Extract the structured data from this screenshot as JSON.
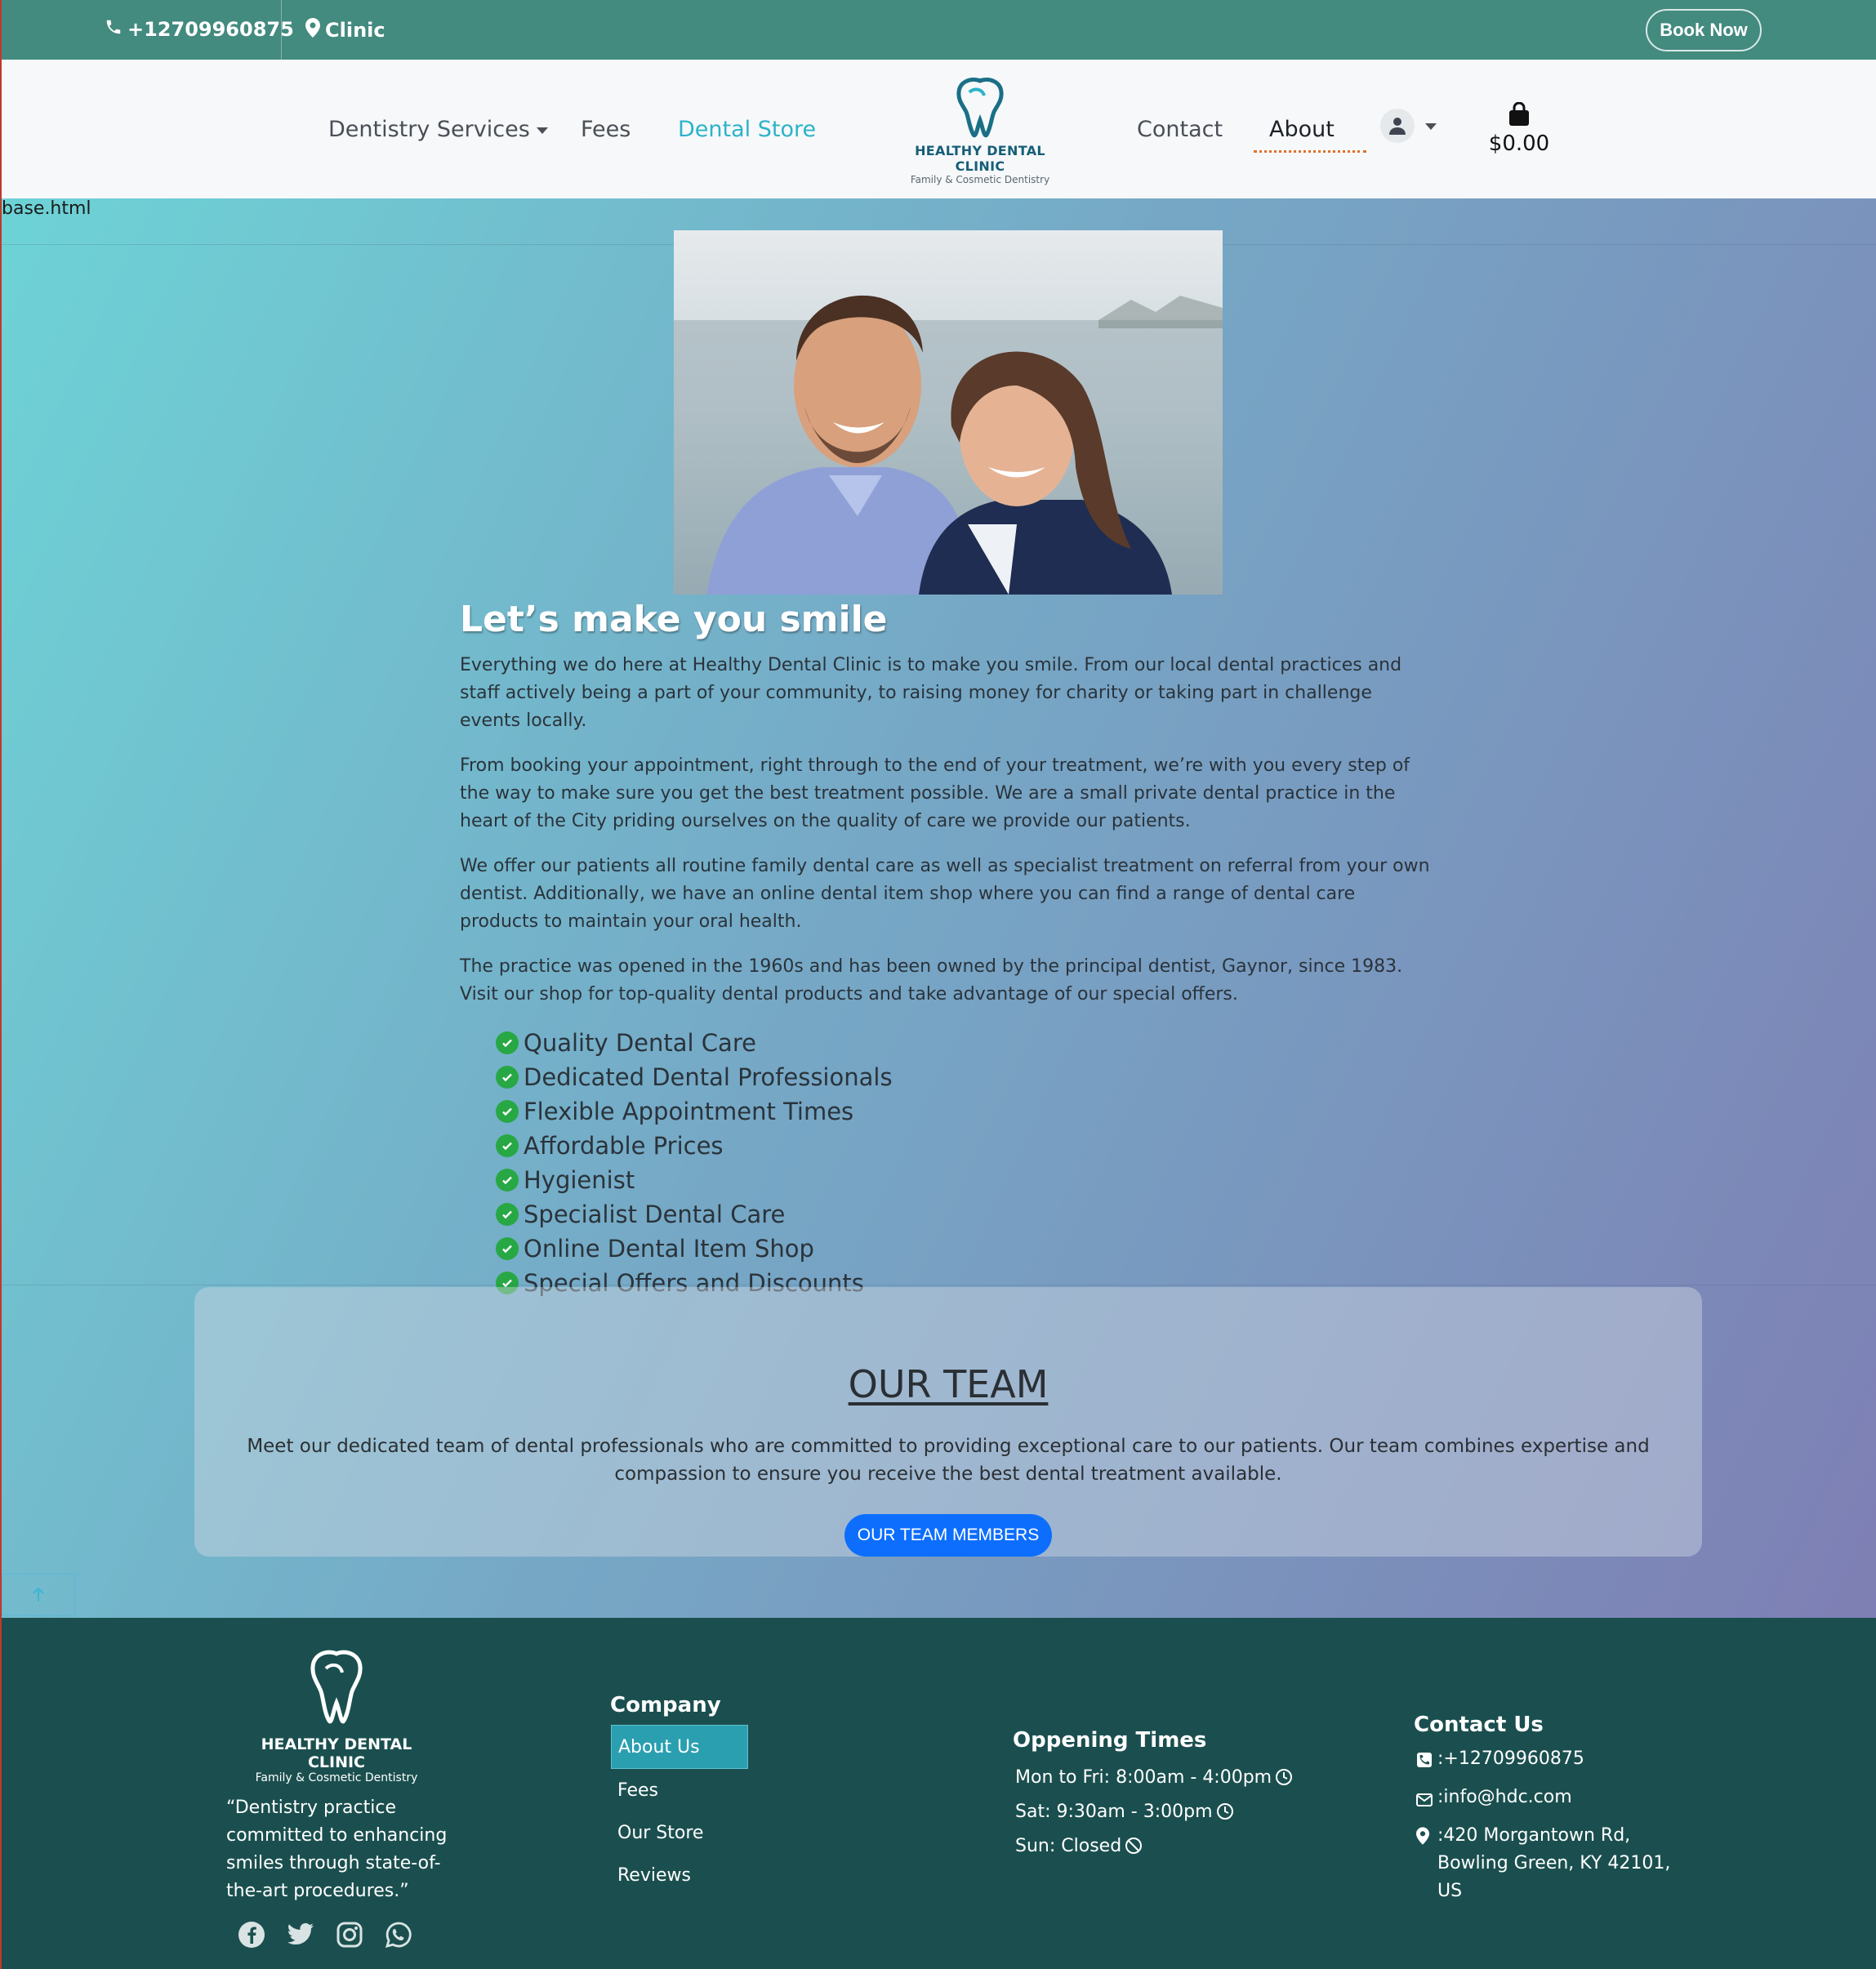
{
  "topbar": {
    "phone": "+12709960875",
    "location": "Clinic",
    "book_label": "Book Now",
    "bg_color": "#438a7f"
  },
  "nav": {
    "items": [
      {
        "label": "Dentistry Services",
        "has_dropdown": true
      },
      {
        "label": "Fees"
      },
      {
        "label": "Dental Store",
        "highlight": true
      },
      {
        "label": "Contact"
      },
      {
        "label": "About",
        "current": true
      }
    ],
    "logo": {
      "brand": "HEALTHY DENTAL CLINIC",
      "tagline": "Family & Cosmetic Dentistry"
    },
    "cart_total": "$0.00",
    "accent_color": "#2cb3c8"
  },
  "main": {
    "file_label": "base.html",
    "heading": "Let’s make you smile",
    "paragraphs": [
      "Everything we do here at Healthy Dental Clinic is to make you smile. From our local dental practices and staff actively being a part of your community, to raising money for charity or taking part in challenge events locally.",
      "From booking your appointment, right through to the end of your treatment, we’re with you every step of the way to make sure you get the best treatment possible. We are a small private dental practice in the heart of the City priding ourselves on the quality of care we provide our patients.",
      "We offer our patients all routine family dental care as well as specialist treatment on referral from your own dentist. Additionally, we have an online dental item shop where you can find a range of dental care products to maintain your oral health.",
      "The practice was opened in the 1960s and has been owned by the principal dentist, Gaynor, since 1983. Visit our shop for top-quality dental products and take advantage of our special offers."
    ],
    "features": [
      "Quality Dental Care",
      "Dedicated Dental Professionals",
      "Flexible Appointment Times",
      "Affordable Prices",
      "Hygienist",
      "Specialist Dental Care",
      "Online Dental Item Shop",
      "Special Offers and Discounts"
    ]
  },
  "team": {
    "title": "OUR TEAM",
    "description": "Meet our dedicated team of dental professionals who are committed to providing exceptional care to our patients. Our team combines expertise and compassion to ensure you receive the best dental treatment available.",
    "button_label": "OUR TEAM MEMBERS",
    "button_color": "#0d6efd"
  },
  "footer": {
    "logo": {
      "brand": "HEALTHY DENTAL CLINIC",
      "tagline": "Family & Cosmetic Dentistry"
    },
    "quote": "“Dentistry practice committed to enhancing smiles through state-of-the-art procedures.”",
    "socials": [
      "facebook-icon",
      "twitter-icon",
      "instagram-icon",
      "whatsapp-icon"
    ],
    "company": {
      "title": "Company",
      "links": [
        "About Us",
        "Fees",
        "Our Store",
        "Reviews"
      ]
    },
    "hours": {
      "title": "Oppening Times",
      "rows": [
        "Mon to Fri: 8:00am - 4:00pm",
        "Sat: 9:30am - 3:00pm",
        "Sun: Closed"
      ]
    },
    "contact": {
      "title": "Contact Us",
      "phone": ":+12709960875",
      "email": ":info@hdc.com",
      "address": ":420 Morgantown Rd, Bowling Green, KY 42101, US"
    },
    "bg_color": "#1b4f4f"
  }
}
